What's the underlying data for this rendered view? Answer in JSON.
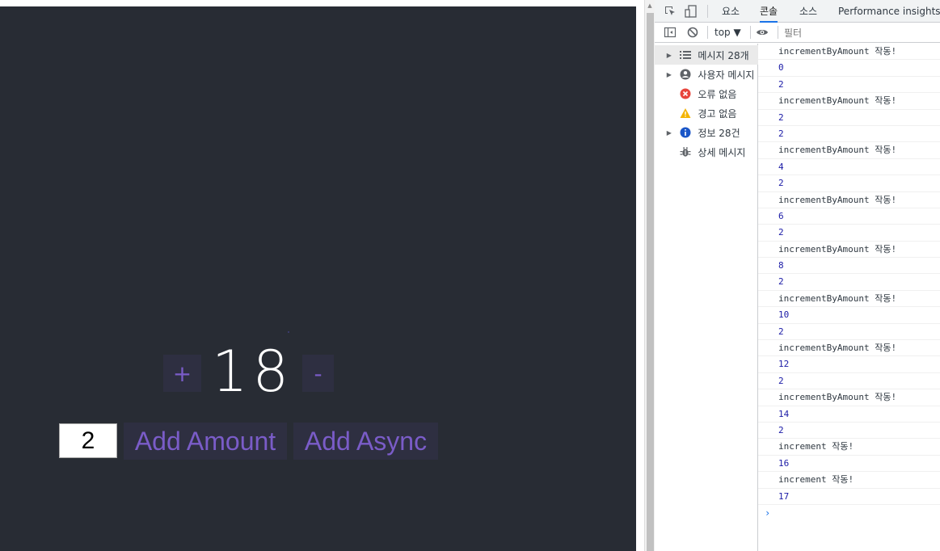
{
  "app": {
    "increment_label": "+",
    "decrement_label": "-",
    "count": "18",
    "amount_value": "2",
    "add_amount_label": "Add Amount",
    "add_async_label": "Add Async"
  },
  "devtools": {
    "tabs": [
      {
        "label": "요소"
      },
      {
        "label": "콘솔"
      },
      {
        "label": "소스"
      },
      {
        "label": "Performance insights"
      }
    ],
    "context": "top ▼",
    "filter_placeholder": "필터",
    "sidebar": [
      {
        "label": "메시지 28개",
        "icon": "list-icon"
      },
      {
        "label": "사용자 메시지",
        "icon": "user-icon"
      },
      {
        "label": "오류 없음",
        "icon": "error-icon"
      },
      {
        "label": "경고 없음",
        "icon": "warning-icon"
      },
      {
        "label": "정보 28건",
        "icon": "info-icon"
      },
      {
        "label": "상세 메시지",
        "icon": "bug-icon"
      }
    ],
    "logs": [
      {
        "text": "incrementByAmount 작동!",
        "kind": "text"
      },
      {
        "text": "0",
        "kind": "num"
      },
      {
        "text": "2",
        "kind": "num"
      },
      {
        "text": "incrementByAmount 작동!",
        "kind": "text"
      },
      {
        "text": "2",
        "kind": "num"
      },
      {
        "text": "2",
        "kind": "num"
      },
      {
        "text": "incrementByAmount 작동!",
        "kind": "text"
      },
      {
        "text": "4",
        "kind": "num"
      },
      {
        "text": "2",
        "kind": "num"
      },
      {
        "text": "incrementByAmount 작동!",
        "kind": "text"
      },
      {
        "text": "6",
        "kind": "num"
      },
      {
        "text": "2",
        "kind": "num"
      },
      {
        "text": "incrementByAmount 작동!",
        "kind": "text"
      },
      {
        "text": "8",
        "kind": "num"
      },
      {
        "text": "2",
        "kind": "num"
      },
      {
        "text": "incrementByAmount 작동!",
        "kind": "text"
      },
      {
        "text": "10",
        "kind": "num"
      },
      {
        "text": "2",
        "kind": "num"
      },
      {
        "text": "incrementByAmount 작동!",
        "kind": "text"
      },
      {
        "text": "12",
        "kind": "num"
      },
      {
        "text": "2",
        "kind": "num"
      },
      {
        "text": "incrementByAmount 작동!",
        "kind": "text"
      },
      {
        "text": "14",
        "kind": "num"
      },
      {
        "text": "2",
        "kind": "num"
      },
      {
        "text": "increment 작동!",
        "kind": "text"
      },
      {
        "text": "16",
        "kind": "num"
      },
      {
        "text": "increment 작동!",
        "kind": "text"
      },
      {
        "text": "17",
        "kind": "num"
      }
    ],
    "prompt": "›"
  },
  "colors": {
    "app_bg": "#282c34",
    "button_bg": "#2e2f41",
    "button_text": "#7a5cc8",
    "devtools_accent": "#1a73e8",
    "number_log": "#1a1aa6"
  }
}
